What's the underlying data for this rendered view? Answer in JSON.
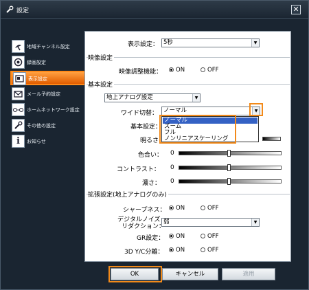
{
  "window": {
    "title": "設定",
    "close_label": "✕"
  },
  "sidebar": {
    "items": [
      {
        "label": "地域チャンネル設定",
        "icon": "satellite-dish-icon"
      },
      {
        "label": "録画設定",
        "icon": "record-icon"
      },
      {
        "label": "表示設定",
        "icon": "display-icon",
        "active": true
      },
      {
        "label": "メール予約設定",
        "icon": "mail-icon"
      },
      {
        "label": "ホームネットワーク設定",
        "icon": "network-icon"
      },
      {
        "label": "その他の設定",
        "icon": "wrench-icon"
      },
      {
        "label": "お知らせ",
        "icon": "info-icon"
      }
    ]
  },
  "display_setting": {
    "label": "表示設定：",
    "value": "5秒"
  },
  "video": {
    "title": "映像設定",
    "adjust_label": "映像調整機能：",
    "on": "ON",
    "off": "OFF"
  },
  "basic": {
    "title": "基本設定",
    "source_value": "地上アナログ設定",
    "wide_label": "ワイド切替：",
    "wide_value": "ノーマル",
    "basic_label": "基本設定：",
    "brightness_label": "明るさ：",
    "color_label": "色合い：",
    "contrast_label": "コントラスト：",
    "depth_label": "濃さ：",
    "color_value": "0",
    "contrast_value": "0",
    "depth_value": "0"
  },
  "dropdown": {
    "options": [
      "ノーマル",
      "ズーム",
      "フル",
      "ノンリニアスケーリング"
    ],
    "selected_index": 0
  },
  "extended": {
    "title": "拡張設定(地上アナログのみ)",
    "sharpness_label": "シャープネス：",
    "dnr_label_line1": "デジタルノイズ",
    "dnr_label_line2": "リダクション：",
    "dnr_value": "弱",
    "gr_label": "GR設定：",
    "ycsep_label": "3D Y/C分離：",
    "on": "ON",
    "off": "OFF"
  },
  "buttons": {
    "ok": "OK",
    "cancel": "キャンセル",
    "apply": "適用"
  },
  "colors": {
    "accent": "#f28a1a",
    "selection": "#3461c4",
    "background": "#1a2531"
  }
}
